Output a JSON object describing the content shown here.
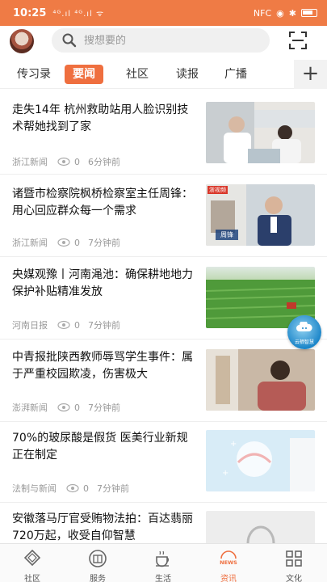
{
  "status_bar": {
    "time": "10:25",
    "signal_text": "⁴ᴳ.ıl ⁴ᴳ.ıl ᯤ",
    "nfc": "NFC"
  },
  "search": {
    "placeholder": "搜想要的"
  },
  "tabs": [
    {
      "label": "传习录",
      "active": false
    },
    {
      "label": "要闻",
      "active": true
    },
    {
      "label": "社区",
      "active": false
    },
    {
      "label": "读报",
      "active": false
    },
    {
      "label": "广播",
      "active": false
    }
  ],
  "tab_add_label": "+",
  "articles": [
    {
      "title": "走失14年 杭州救助站用人脸识别技术帮她找到了家",
      "source": "浙江新闻",
      "views": "0",
      "time": "6分钟前"
    },
    {
      "title": "诸暨市检察院枫桥检察室主任周锋：用心回应群众每一个需求",
      "source": "浙江新闻",
      "views": "0",
      "time": "7分钟前"
    },
    {
      "title": "央媒观豫丨河南渑池：确保耕地地力保护补贴精准发放",
      "source": "河南日报",
      "views": "0",
      "time": "7分钟前"
    },
    {
      "title": "中青报批陕西教师辱骂学生事件：属于严重校园欺凌，伤害极大",
      "source": "澎湃新闻",
      "views": "0",
      "time": "7分钟前"
    },
    {
      "title": "70%的玻尿酸是假货 医美行业新规正在制定",
      "source": "法制与新闻",
      "views": "0",
      "time": "7分钟前"
    },
    {
      "title": "安徽落马厅官受贿物法拍：百达翡丽720万起，收受自仰智慧",
      "source": "",
      "views": "",
      "time": ""
    }
  ],
  "thumb2_caption": "周锋",
  "thumb2_tag": "浙视频",
  "float_button_label": "云栖智慧",
  "bottom_nav": [
    {
      "label": "社区",
      "active": false
    },
    {
      "label": "服务",
      "active": false
    },
    {
      "label": "生活",
      "active": false
    },
    {
      "label": "资讯",
      "active": true
    },
    {
      "label": "文化",
      "active": false
    }
  ],
  "news_badge": "NEWS",
  "colors": {
    "accent": "#ef6f3f",
    "status_bar": "#ef7b45"
  }
}
